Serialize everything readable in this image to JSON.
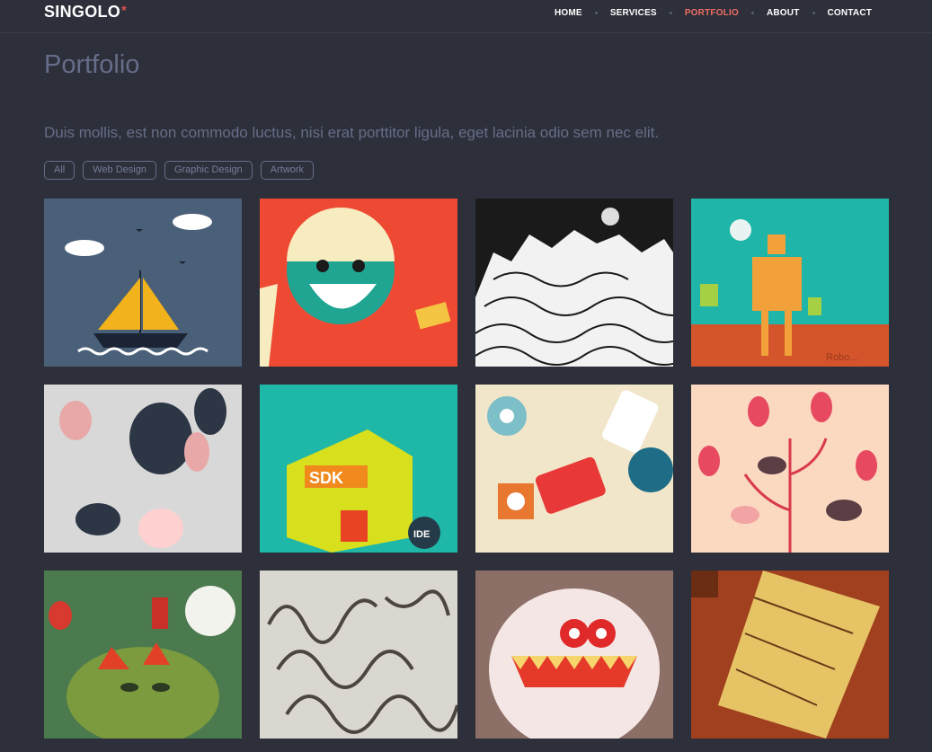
{
  "header": {
    "logo_text": "SINGOLO",
    "logo_star": "*",
    "nav": [
      {
        "label": "HOME",
        "active": false
      },
      {
        "label": "SERVICES",
        "active": false
      },
      {
        "label": "PORTFOLIO",
        "active": true
      },
      {
        "label": "ABOUT",
        "active": false
      },
      {
        "label": "CONTACT",
        "active": false
      }
    ]
  },
  "portfolio": {
    "title": "Portfolio",
    "subtitle": "Duis mollis, est non commodo luctus, nisi erat porttitor ligula, eget lacinia odio sem nec elit.",
    "filters": [
      "All",
      "Web Design",
      "Graphic Design",
      "Artwork"
    ]
  },
  "colors": {
    "background": "#2d303a",
    "accent": "#f06c64",
    "muted_text": "#666d89"
  },
  "gallery": [
    {
      "name": "sailboat-illustration",
      "tile_text": ""
    },
    {
      "name": "smiling-girl-illustration",
      "tile_text": ""
    },
    {
      "name": "black-white-city-illustration",
      "tile_text": ""
    },
    {
      "name": "robot-illustration",
      "tile_text": "Robo..."
    },
    {
      "name": "monsters-pattern-illustration",
      "tile_text": ""
    },
    {
      "name": "sdk-ide-illustration",
      "tile_text": "SDK"
    },
    {
      "name": "robots-pattern-illustration",
      "tile_text": ""
    },
    {
      "name": "chickens-eggs-illustration",
      "tile_text": ""
    },
    {
      "name": "green-monster-castle-illustration",
      "tile_text": ""
    },
    {
      "name": "ribbon-lettering-illustration",
      "tile_text": ""
    },
    {
      "name": "white-monster-illustration",
      "tile_text": ""
    },
    {
      "name": "treasure-map-illustration",
      "tile_text": ""
    }
  ],
  "gallery_extra_text": {
    "ide_badge": "IDE"
  }
}
